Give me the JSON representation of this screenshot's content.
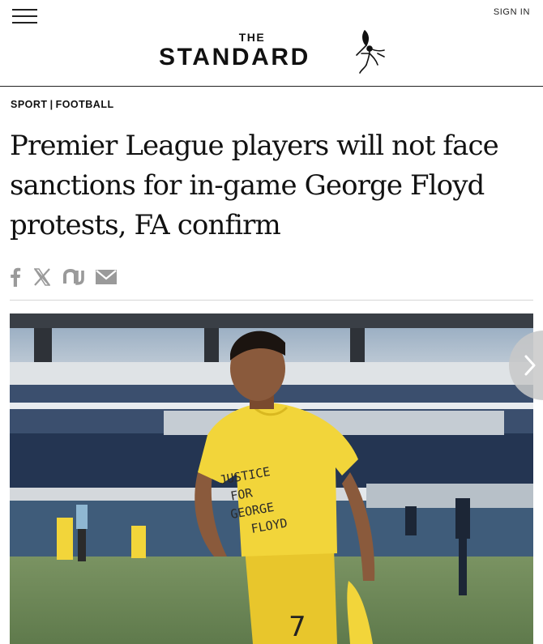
{
  "header": {
    "menu_icon": "hamburger-menu-icon",
    "sign_in_label": "SIGN IN",
    "logo_the": "THE",
    "logo_standard": "STANDARD",
    "logo_figure_icon": "eros-statue-icon"
  },
  "breadcrumb": {
    "section": "SPORT",
    "separator": "|",
    "subsection": "FOOTBALL"
  },
  "article": {
    "headline": "Premier League players will not face sanctions for in-game George Floyd protests, FA confirm"
  },
  "share": {
    "icons": [
      "facebook-icon",
      "x-icon",
      "newsbreak-icon",
      "email-icon"
    ],
    "icon_color": "#9a9a9a"
  },
  "hero": {
    "shirt_text": [
      "JUSTICE",
      "FOR",
      "GEORGE",
      "FLOYD"
    ],
    "shirt_number": "7",
    "next_icon": "chevron-right-icon"
  },
  "colors": {
    "text": "#111111",
    "divider": "#d6d6d6",
    "shirt_yellow": "#f2d53a",
    "pitch_green": "#6f8a5a"
  }
}
